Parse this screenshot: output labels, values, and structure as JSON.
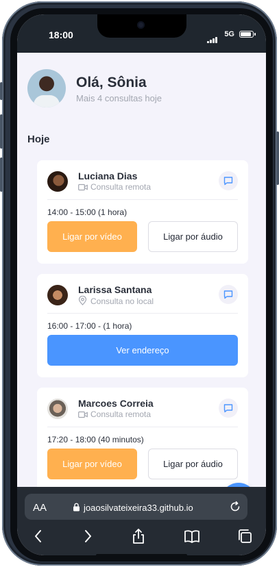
{
  "status": {
    "time": "18:00",
    "network": "5G"
  },
  "header": {
    "greeting": "Olá, Sônia",
    "subtitle": "Mais 4 consultas hoje"
  },
  "section_title": "Hoje",
  "appointments": [
    {
      "name": "Luciana Dias",
      "type": "Consulta remota",
      "type_icon": "video-icon",
      "time": "14:00 - 15:00 (1 hora)",
      "primary_button": "Ligar por vídeo",
      "secondary_button": "Ligar por áudio"
    },
    {
      "name": "Larissa Santana",
      "type": "Consulta no local",
      "type_icon": "location-pin-icon",
      "time": "16:00 - 17:00 - (1 hora)",
      "primary_button": "Ver endereço"
    },
    {
      "name": "Marcoes Correia",
      "type": "Consulta remota",
      "type_icon": "video-icon",
      "time": "17:20 - 18:00 (40 minutos)",
      "primary_button": "Ligar por vídeo",
      "secondary_button": "Ligar por áudio"
    }
  ],
  "fab": {
    "label": "+"
  },
  "browser": {
    "text_size": "AA",
    "url": "joaosilvateixeira33.github.io"
  },
  "colors": {
    "accent_blue": "#4a95ff",
    "accent_orange": "#ffb04f",
    "background": "#f4f3fb"
  }
}
